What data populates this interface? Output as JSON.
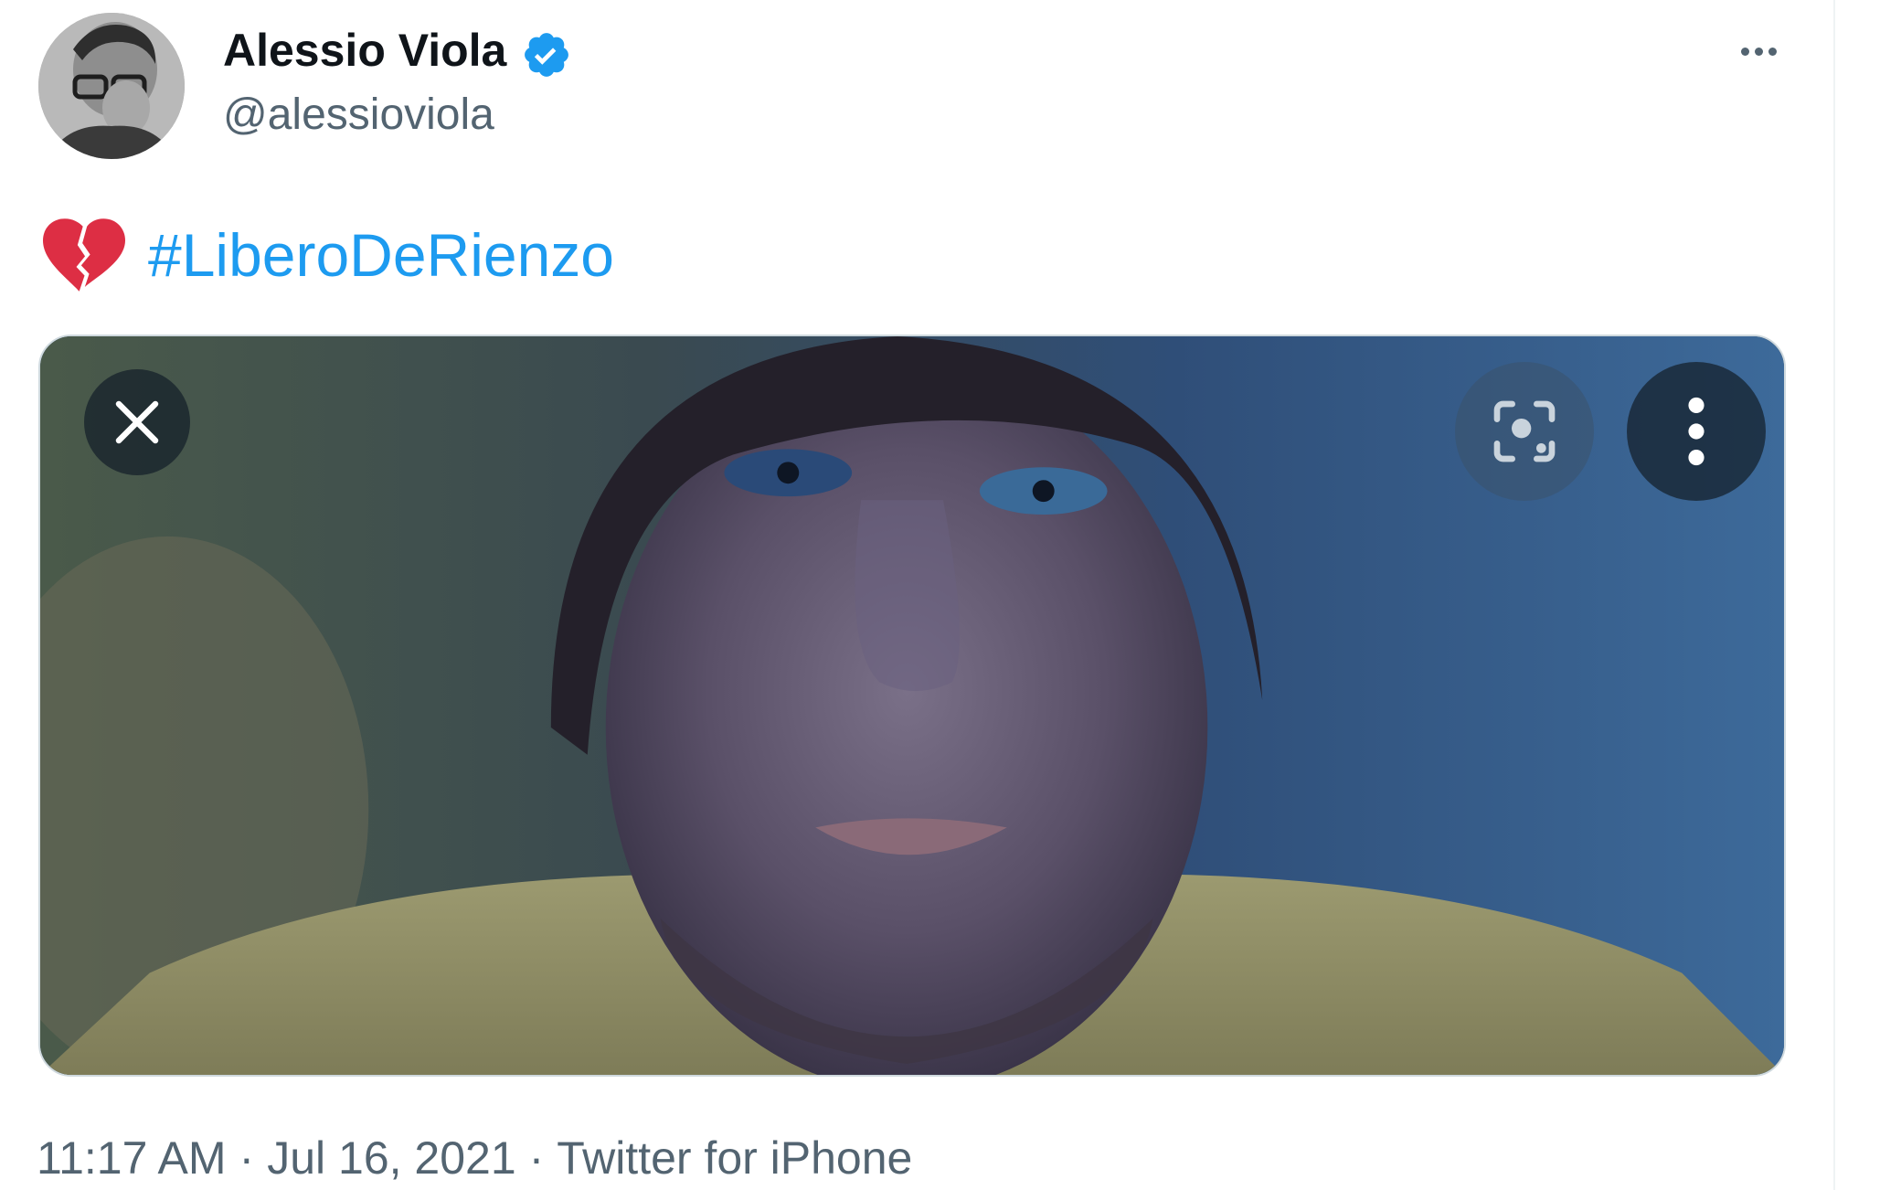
{
  "author": {
    "display_name": "Alessio Viola",
    "handle": "@alessioviola",
    "verified": true
  },
  "tweet": {
    "emoji": "broken-heart",
    "hashtag": "#LiberoDeRienzo"
  },
  "media_controls": {
    "close_icon": "close-icon",
    "lens_icon": "visual-search-icon",
    "menu_icon": "vertical-dots-icon"
  },
  "footer": {
    "time": "11:17 AM",
    "separator": "·",
    "date": "Jul 16, 2021",
    "source": "Twitter for iPhone"
  },
  "colors": {
    "link_blue": "#1d9bf0",
    "text_primary": "#0f1419",
    "text_secondary": "#536471",
    "broken_heart_red": "#dd2e44"
  }
}
